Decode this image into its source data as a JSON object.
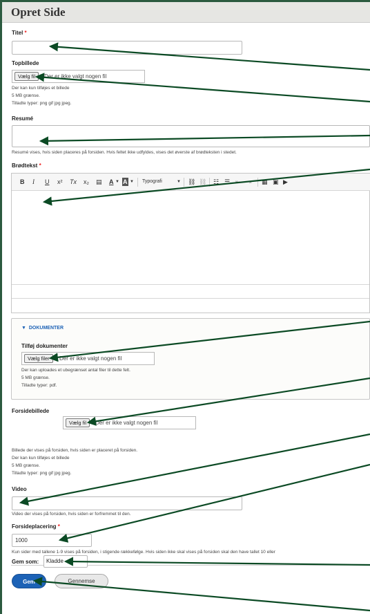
{
  "page": {
    "title": "Opret Side"
  },
  "titel": {
    "label": "Titel",
    "required": "*",
    "value": ""
  },
  "topbillede": {
    "label": "Topbillede",
    "button": "Vælg fil",
    "status": "Der er ikke valgt nogen fil",
    "help": [
      "Der kan kun tilføjes et billede",
      "5 MB grænse.",
      "Tilladte typer: png gif jpg jpeg."
    ]
  },
  "resume": {
    "label": "Resumé",
    "value": "",
    "help": "Resumé vises, hvis siden placeres på forsiden. Hvis feltet ikke udfyldes, vises det øverste af brødteksten i stedet."
  },
  "brodtekst": {
    "label": "Brødtekst",
    "required": "*",
    "toolbar": {
      "bold": "B",
      "italic": "I",
      "underline": "U",
      "superscript": "x²",
      "remove_format": "Tx",
      "subscript": "x₂",
      "paste": "▤",
      "text_color": "A",
      "bg_color": "A",
      "format": "Typografi"
    }
  },
  "dokumenter": {
    "legend": "DOKUMENTER",
    "label": "Tilføj dokumenter",
    "button": "Vælg filer",
    "status": "Der er ikke valgt nogen fil",
    "help": [
      "Der kan uploades et ubegrænset antal filer til dette felt.",
      "5 MB grænse.",
      "Tilladte typer: pdf."
    ]
  },
  "forsidebillede": {
    "label": "Forsidebillede",
    "button": "Vælg fil",
    "status": "Der er ikke valgt nogen fil",
    "help": [
      "Billede der vises på forsiden, hvis siden er placeret på forsiden.",
      "Der kan kun tilføjes et billede",
      "5 MB grænse.",
      "Tilladte typer: png gif jpg jpeg."
    ]
  },
  "video": {
    "label": "Video",
    "value": "",
    "help": "Video der vises på forsiden, hvis siden er forfremmet til den."
  },
  "forsideplacering": {
    "label": "Forsideplacering",
    "required": "*",
    "value": "1000",
    "help": "Kun sider med tallene 1-9 vises på forsiden, i stigende rækkefølge. Hvis siden ikke skal vises på forsiden skal den have tallet 10 eller"
  },
  "gem_som": {
    "label": "Gem som:",
    "selected": "Kladde"
  },
  "actions": {
    "save": "Gem",
    "browse": "Gennemse"
  },
  "colors": {
    "frame": "#2b5a3f",
    "primary_button": "#1c62b6",
    "arrow": "#0b4a24",
    "required": "#e22222"
  }
}
